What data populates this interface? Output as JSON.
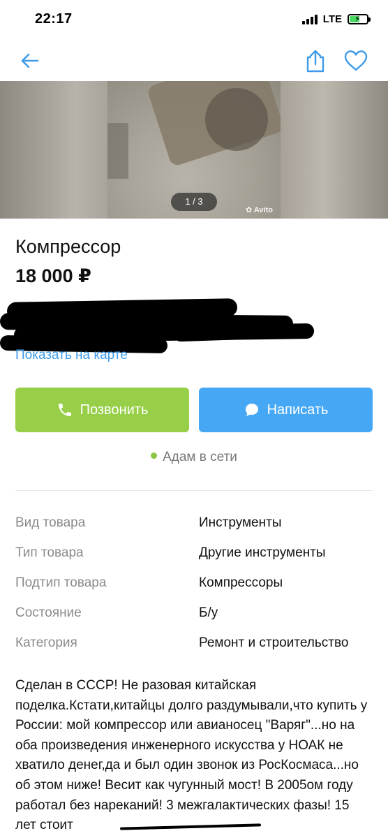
{
  "status_bar": {
    "time": "22:17",
    "network": "LTE"
  },
  "nav": {
    "back_icon": "arrow-left-icon",
    "share_icon": "share-icon",
    "favorite_icon": "heart-icon",
    "accent_color": "#3e9bea"
  },
  "gallery": {
    "counter": "1 / 3",
    "watermark": "Avito"
  },
  "listing": {
    "title": "Компрессор",
    "price": "18 000 ₽",
    "map_link": "Показать на карте"
  },
  "actions": {
    "call_label": "Позвонить",
    "call_color": "#97cf48",
    "write_label": "Написать",
    "write_color": "#46a8f4"
  },
  "seller": {
    "online_status": "Адам в сети"
  },
  "params": [
    {
      "label": "Вид товара",
      "value": "Инструменты"
    },
    {
      "label": "Тип товара",
      "value": "Другие инструменты"
    },
    {
      "label": "Подтип товара",
      "value": "Компрессоры"
    },
    {
      "label": "Состояние",
      "value": "Б/у"
    },
    {
      "label": "Категория",
      "value": "Ремонт и строительство"
    }
  ],
  "description": "Сделан в СССР! Не разовая китайская поделка.Кстати,китайцы долго раздумывали,что купить у России: мой компрессор или авианосец \"Варяг\"...но на оба произведения инженерного искусства у НОАК не хватило денег,да и был один звонок из РосКосмаса...но об этом ниже! Весит как чугунный мост! В 2005ом году работал без нареканий! 3 межгалактических фазы! 15 лет стоит"
}
